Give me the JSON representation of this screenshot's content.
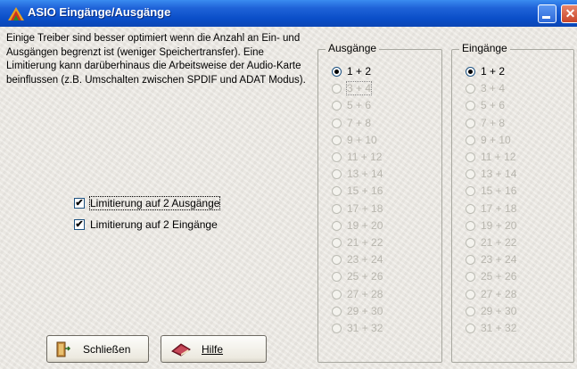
{
  "window": {
    "title": "ASIO Eingänge/Ausgänge",
    "close_glyph": "✕"
  },
  "description": "Einige Treiber sind besser optimiert wenn die Anzahl an Ein- und Ausgängen begrenzt ist (weniger Speichertransfer). Eine Limitierung kann darüberhinaus die Arbeitsweise der Audio-Karte beinflussen (z.B. Umschalten zwischen SPDIF und ADAT Modus).",
  "options": {
    "limit_outputs": {
      "label": "Limitierung auf 2 Ausgänge",
      "checked": true,
      "mark": "✔"
    },
    "limit_inputs": {
      "label": "Limitierung auf 2 Eingänge",
      "checked": true,
      "mark": "✔"
    }
  },
  "outputs": {
    "title": "Ausgänge",
    "selected": "1 + 2",
    "items": [
      "1 + 2",
      "3 + 4",
      "5 + 6",
      "7 + 8",
      "9 + 10",
      "11 + 12",
      "13 + 14",
      "15 + 16",
      "17 + 18",
      "19 + 20",
      "21 + 22",
      "23 + 24",
      "25 + 26",
      "27 + 28",
      "29 + 30",
      "31 + 32"
    ]
  },
  "inputs": {
    "title": "Eingänge",
    "selected": "1 + 2",
    "items": [
      "1 + 2",
      "3 + 4",
      "5 + 6",
      "7 + 8",
      "9 + 10",
      "11 + 12",
      "13 + 14",
      "15 + 16",
      "17 + 18",
      "19 + 20",
      "21 + 22",
      "23 + 24",
      "25 + 26",
      "27 + 28",
      "29 + 30",
      "31 + 32"
    ]
  },
  "buttons": {
    "close": {
      "label": "Schließen",
      "icon": "exit-door-icon"
    },
    "help": {
      "label": "Hilfe",
      "icon": "help-book-icon"
    }
  },
  "colors": {
    "titlebar": "#0a4ec8",
    "disabled_text": "#b8b6ae"
  }
}
